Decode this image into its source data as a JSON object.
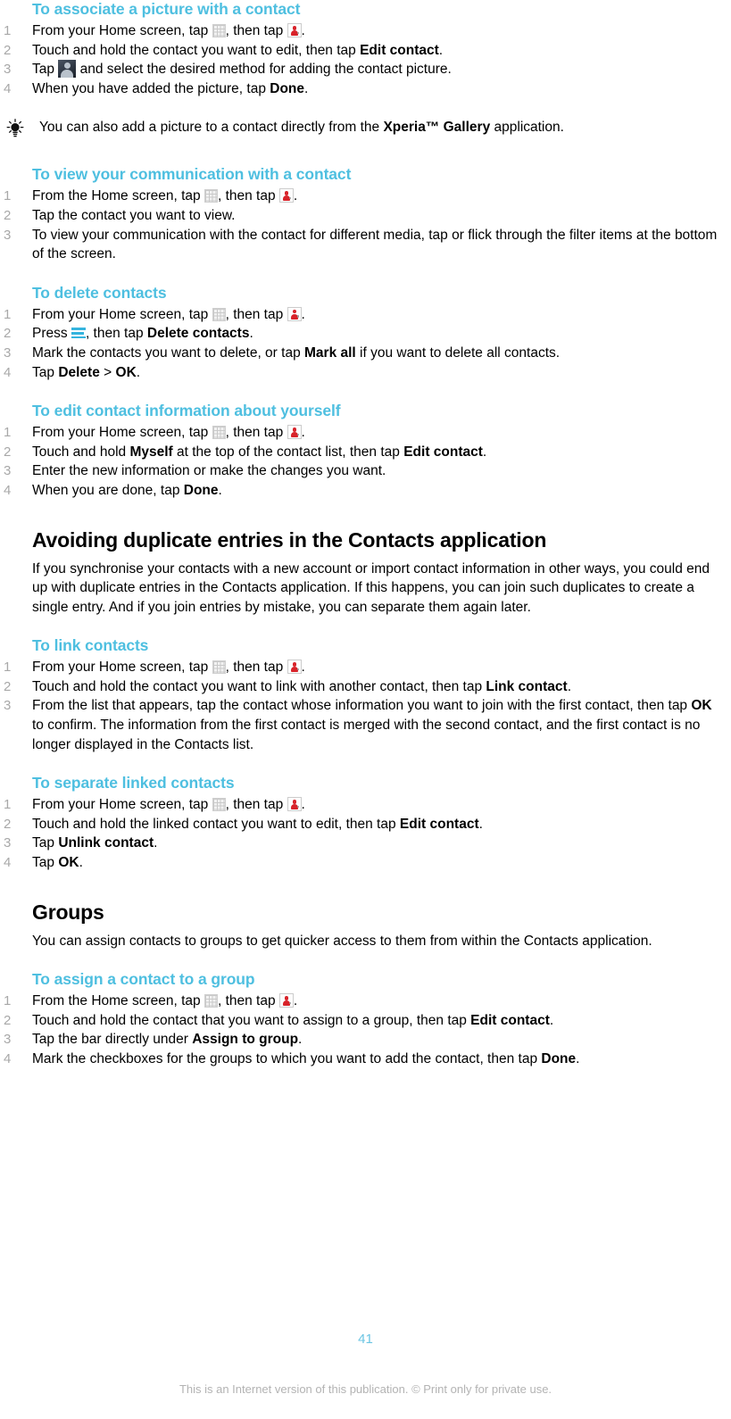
{
  "document": {
    "page_number": "41",
    "footer_note": "This is an Internet version of this publication. © Print only for private use.",
    "heading_color": "#4ebfe0",
    "step_number_color": "#a8a8a8",
    "page_number_color": "#6cc5e3"
  },
  "icons": {
    "app_drawer": "grid-icon",
    "contacts": "contacts-icon",
    "contact_photo": "contact-photo-icon",
    "menu": "menu-icon",
    "tip": "lightbulb-icon"
  },
  "sections": {
    "associate_picture": {
      "heading": "To associate a picture with a contact",
      "steps": {
        "s1_a": "From your Home screen, tap ",
        "s1_b": ", then tap ",
        "s1_c": ".",
        "s2_a": "Touch and hold the contact you want to edit, then tap ",
        "s2_b": "Edit contact",
        "s2_c": ".",
        "s3_a": "Tap ",
        "s3_b": " and select the desired method for adding the contact picture.",
        "s4_a": "When you have added the picture, tap ",
        "s4_b": "Done",
        "s4_c": "."
      },
      "tip": {
        "a": "You can also add a picture to a contact directly from the ",
        "b": "Xperia™ Gallery",
        "c": " application."
      }
    },
    "view_communication": {
      "heading": "To view your communication with a contact",
      "steps": {
        "s1_a": "From the Home screen, tap ",
        "s1_b": ", then tap ",
        "s1_c": ".",
        "s2": "Tap the contact you want to view.",
        "s3": "To view your communication with the contact for different media, tap or flick through the filter items at the bottom of the screen."
      }
    },
    "delete_contacts": {
      "heading": "To delete contacts",
      "steps": {
        "s1_a": "From your Home screen, tap ",
        "s1_b": ", then tap ",
        "s1_c": ".",
        "s2_a": "Press ",
        "s2_b": ", then tap ",
        "s2_c": "Delete contacts",
        "s2_d": ".",
        "s3_a": "Mark the contacts you want to delete, or tap ",
        "s3_b": "Mark all",
        "s3_c": " if you want to delete all contacts.",
        "s4_a": "Tap ",
        "s4_b": "Delete",
        "s4_c": " > ",
        "s4_d": "OK",
        "s4_e": "."
      }
    },
    "edit_own_info": {
      "heading": "To edit contact information about yourself",
      "steps": {
        "s1_a": "From your Home screen, tap ",
        "s1_b": ", then tap ",
        "s1_c": ".",
        "s2_a": "Touch and hold ",
        "s2_b": "Myself",
        "s2_c": " at the top of the contact list, then tap ",
        "s2_d": "Edit contact",
        "s2_e": ".",
        "s3": "Enter the new information or make the changes you want.",
        "s4_a": "When you are done, tap ",
        "s4_b": "Done",
        "s4_c": "."
      }
    },
    "avoiding_duplicates": {
      "heading": "Avoiding duplicate entries in the Contacts application",
      "body": "If you synchronise your contacts with a new account or import contact information in other ways, you could end up with duplicate entries in the Contacts application. If this happens, you can join such duplicates to create a single entry. And if you join entries by mistake, you can separate them again later."
    },
    "link_contacts": {
      "heading": "To link contacts",
      "steps": {
        "s1_a": "From your Home screen, tap ",
        "s1_b": ", then tap ",
        "s1_c": ".",
        "s2_a": "Touch and hold the contact you want to link with another contact, then tap ",
        "s2_b": "Link contact",
        "s2_c": ".",
        "s3_a": "From the list that appears, tap the contact whose information you want to join with the first contact, then tap ",
        "s3_b": "OK",
        "s3_c": " to confirm. The information from the first contact is merged with the second contact, and the first contact is no longer displayed in the Contacts list."
      }
    },
    "separate_linked": {
      "heading": "To separate linked contacts",
      "steps": {
        "s1_a": "From your Home screen, tap ",
        "s1_b": ", then tap ",
        "s1_c": ".",
        "s2_a": "Touch and hold the linked contact you want to edit, then tap ",
        "s2_b": "Edit contact",
        "s2_c": ".",
        "s3_a": "Tap ",
        "s3_b": "Unlink contact",
        "s3_c": ".",
        "s4_a": "Tap ",
        "s4_b": "OK",
        "s4_c": "."
      }
    },
    "groups": {
      "heading": "Groups",
      "body": "You can assign contacts to groups to get quicker access to them from within the Contacts application."
    },
    "assign_group": {
      "heading": "To assign a contact to a group",
      "steps": {
        "s1_a": "From the Home screen, tap ",
        "s1_b": ", then tap ",
        "s1_c": ".",
        "s2_a": "Touch and hold the contact that you want to assign to a group, then tap ",
        "s2_b": "Edit contact",
        "s2_c": ".",
        "s3_a": "Tap the bar directly under ",
        "s3_b": "Assign to group",
        "s3_c": ".",
        "s4_a": "Mark the checkboxes for the groups to which you want to add the contact, then tap ",
        "s4_b": "Done",
        "s4_c": "."
      }
    }
  }
}
